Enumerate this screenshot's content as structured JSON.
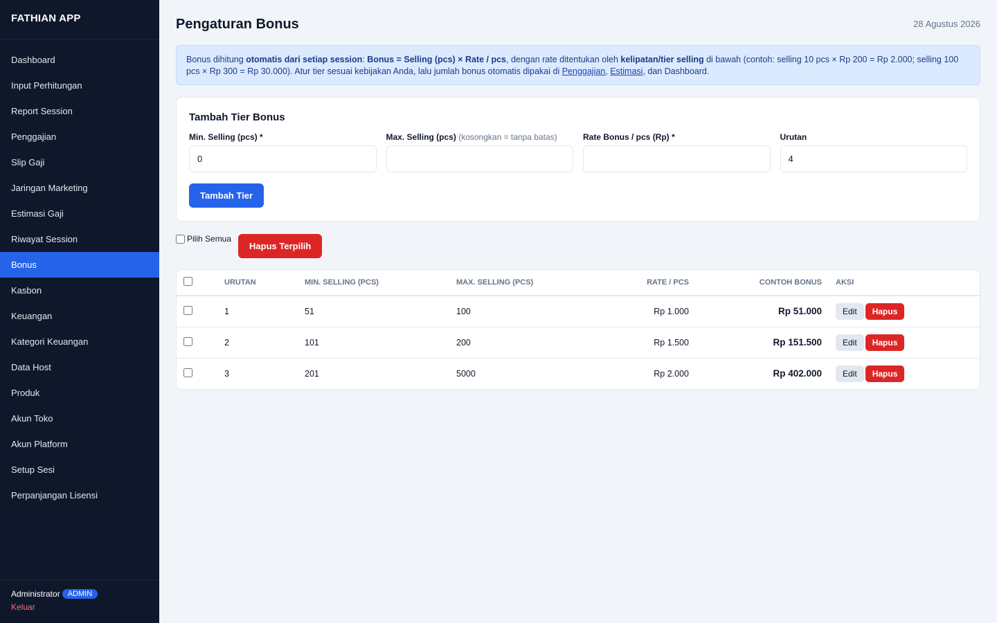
{
  "app": {
    "title": "FATHIAN APP"
  },
  "sidebar": {
    "items": [
      {
        "label": "Dashboard"
      },
      {
        "label": "Input Perhitungan"
      },
      {
        "label": "Report Session"
      },
      {
        "label": "Penggajian"
      },
      {
        "label": "Slip Gaji"
      },
      {
        "label": "Jaringan Marketing"
      },
      {
        "label": "Estimasi Gaji"
      },
      {
        "label": "Riwayat Session"
      },
      {
        "label": "Bonus",
        "active": true
      },
      {
        "label": "Kasbon"
      },
      {
        "label": "Keuangan"
      },
      {
        "label": "Kategori Keuangan"
      },
      {
        "label": "Data Host"
      },
      {
        "label": "Produk"
      },
      {
        "label": "Akun Toko"
      },
      {
        "label": "Akun Platform"
      },
      {
        "label": "Setup Sesi"
      },
      {
        "label": "Perpanjangan Lisensi"
      }
    ],
    "user": {
      "name": "Administrator",
      "role": "ADMIN"
    },
    "logout_label": "Keluar"
  },
  "header": {
    "title": "Pengaturan Bonus",
    "date": "28 Agustus 2026"
  },
  "info": {
    "t1": "Bonus dihitung ",
    "b1": "otomatis dari setiap session",
    "t2": ": ",
    "b2": "Bonus = Selling (pcs) × Rate / pcs",
    "t3": ", dengan rate ditentukan oleh ",
    "b3": "kelipatan/tier selling",
    "t4": " di bawah (contoh: selling 10 pcs × Rp 200 = Rp 2.000; selling 100 pcs × Rp 300 = Rp 30.000). Atur tier sesuai kebijakan Anda, lalu jumlah bonus otomatis dipakai di ",
    "link1": "Penggajian",
    "t5": ", ",
    "link2": "Estimasi",
    "t6": ", dan Dashboard."
  },
  "form": {
    "title": "Tambah Tier Bonus",
    "min_label": "Min. Selling (pcs) *",
    "min_value": "0",
    "max_label": "Max. Selling (pcs)",
    "max_hint": "(kosongkan = tanpa batas)",
    "max_value": "",
    "rate_label": "Rate Bonus / pcs (Rp) *",
    "rate_value": "",
    "order_label": "Urutan",
    "order_value": "4",
    "submit_label": "Tambah Tier"
  },
  "bulk": {
    "select_all_label": "Pilih Semua",
    "delete_selected_label": "Hapus Terpilih"
  },
  "table": {
    "headers": {
      "order": "Urutan",
      "min": "Min. Selling (pcs)",
      "max": "Max. Selling (pcs)",
      "rate": "Rate / pcs",
      "example": "Contoh Bonus",
      "action": "Aksi"
    },
    "rows": [
      {
        "order": "1",
        "min": "51",
        "max": "100",
        "rate": "Rp 1.000",
        "example": "Rp 51.000"
      },
      {
        "order": "2",
        "min": "101",
        "max": "200",
        "rate": "Rp 1.500",
        "example": "Rp 151.500"
      },
      {
        "order": "3",
        "min": "201",
        "max": "5000",
        "rate": "Rp 2.000",
        "example": "Rp 402.000"
      }
    ],
    "edit_label": "Edit",
    "delete_label": "Hapus"
  }
}
